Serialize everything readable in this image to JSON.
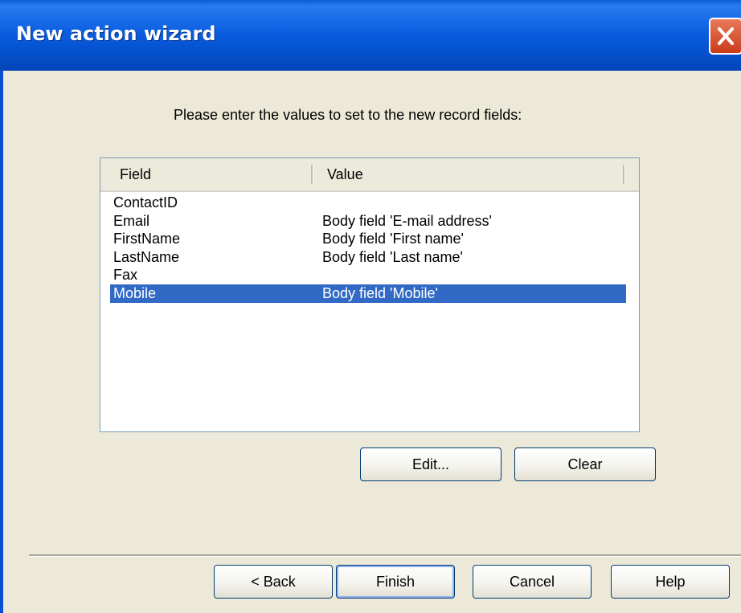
{
  "window": {
    "title": "New action wizard"
  },
  "prompt": "Please enter the values to set to the new record fields:",
  "table": {
    "columns": [
      "Field",
      "Value"
    ],
    "rows": [
      {
        "field": "ContactID",
        "value": ""
      },
      {
        "field": "Email",
        "value": "Body field 'E-mail address'"
      },
      {
        "field": "FirstName",
        "value": "Body field 'First name'"
      },
      {
        "field": "LastName",
        "value": "Body field 'Last name'"
      },
      {
        "field": "Fax",
        "value": ""
      },
      {
        "field": "Mobile",
        "value": "Body field 'Mobile'"
      }
    ],
    "selected_row": "Mobile"
  },
  "buttons": {
    "edit": "Edit...",
    "clear": "Clear",
    "back": "< Back",
    "finish": "Finish",
    "cancel": "Cancel",
    "help": "Help"
  },
  "colors": {
    "titlebar": "#0554d6",
    "selection": "#316ac5",
    "face": "#ece9d8"
  }
}
